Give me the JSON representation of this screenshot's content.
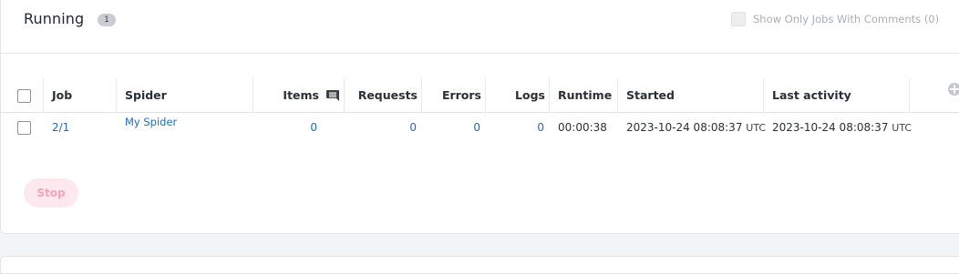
{
  "section": {
    "title": "Running",
    "count": "1",
    "comments_filter_label": "Show Only Jobs With Comments (0)"
  },
  "table": {
    "columns": {
      "job": "Job",
      "spider": "Spider",
      "items": "Items",
      "requests": "Requests",
      "errors": "Errors",
      "logs": "Logs",
      "runtime": "Runtime",
      "started": "Started",
      "last_activity": "Last activity"
    },
    "rows": [
      {
        "job": "2/1",
        "spider": "My Spider",
        "items": "0",
        "requests": "0",
        "errors": "0",
        "logs": "0",
        "runtime": "00:00:38",
        "started": "2023-10-24 08:08:37",
        "started_tz": "UTC",
        "last_activity": "2023-10-24 08:08:37",
        "last_activity_tz": "UTC"
      }
    ]
  },
  "actions": {
    "stop_label": "Stop"
  },
  "icons": {
    "comments_column": "comment-icon",
    "columns_settings": "column-settings-icon"
  },
  "colors": {
    "link": "#1f6cc0",
    "stop_button_bg": "#fde8ee",
    "stop_button_text": "#f0a6bb",
    "badge_bg": "#c9cdd2"
  }
}
